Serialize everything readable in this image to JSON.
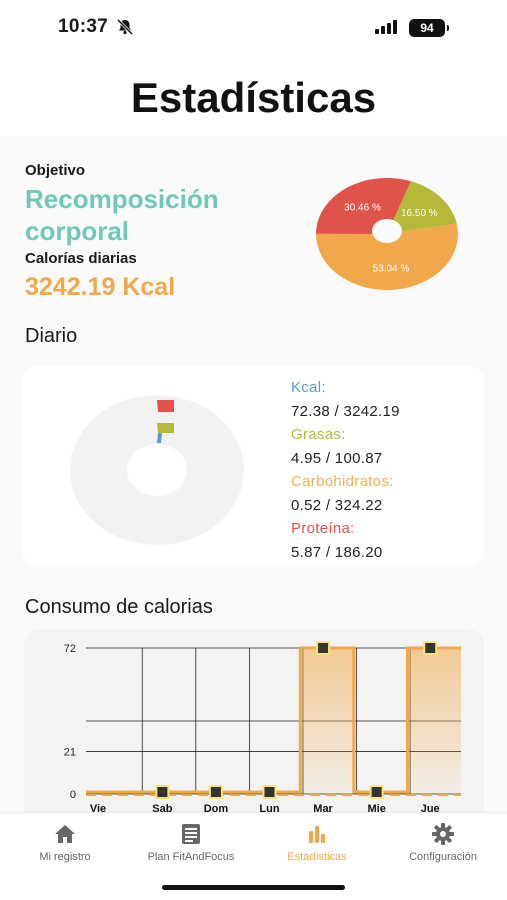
{
  "status": {
    "time": "10:37",
    "battery": "94"
  },
  "page": {
    "title": "Estadísticas"
  },
  "objective": {
    "label": "Objetivo",
    "value": "Recomposición corporal",
    "calories_label": "Calorías diarias",
    "calories_value": "3242.19 Kcal"
  },
  "distribution_pie": {
    "slices": [
      {
        "label": "30.46 %",
        "value": 30.46,
        "color": "#e0534a"
      },
      {
        "label": "16.50 %",
        "value": 16.5,
        "color": "#b6b83a"
      },
      {
        "label": "53.04 %",
        "value": 53.04,
        "color": "#f0a84a"
      }
    ]
  },
  "daily": {
    "title": "Diario",
    "kcal_label": "Kcal:",
    "kcal_value": "72.38 / 3242.19",
    "fat_label": "Grasas:",
    "fat_value": "4.95 / 100.87",
    "carbs_label": "Carbohidratos:",
    "carbs_value": "0.52 / 324.22",
    "protein_label": "Proteína:",
    "protein_value": "5.87 / 186.20",
    "colors": {
      "kcal": "#5b9bd5",
      "fat": "#b6b83a",
      "carbs": "#f0b050",
      "protein": "#e0534a"
    }
  },
  "consumption": {
    "title": "Consumo de calorias"
  },
  "chart_data": {
    "type": "area",
    "categories": [
      "Vie",
      "Sab",
      "Dom",
      "Lun",
      "Mar",
      "Mie",
      "Jue"
    ],
    "values": [
      0,
      0,
      0,
      0,
      72,
      0,
      72
    ],
    "y_tick_labels": [
      "72",
      "21",
      "0"
    ],
    "ylim": [
      0,
      72
    ],
    "grid": true,
    "color": "#f0a84a"
  },
  "tabs": [
    {
      "label": "Mi registro",
      "icon": "home-icon",
      "active": false
    },
    {
      "label": "Plan FitAndFocus",
      "icon": "list-icon",
      "active": false
    },
    {
      "label": "Estadísticas",
      "icon": "bar-chart-icon",
      "active": true
    },
    {
      "label": "Configuración",
      "icon": "gear-icon",
      "active": false
    }
  ]
}
